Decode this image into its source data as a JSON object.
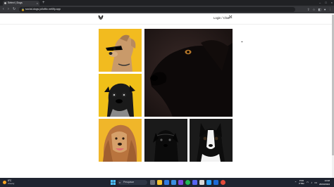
{
  "browser": {
    "tab_title": "Select | Dogs",
    "tab_close": "×",
    "new_tab": "+",
    "window_controls": [
      "–",
      "□",
      "×"
    ],
    "nav": {
      "back": "‹",
      "forward": "›",
      "reload": "↻"
    },
    "lock_icon": "🔒",
    "url": "social-dogs.jolloftic.netlify.app"
  },
  "page": {
    "header": {
      "login_label": "Login / Chat"
    },
    "photos": [
      {
        "id": "dog-sunglasses",
        "bg": "#f2bb1f"
      },
      {
        "id": "black-lab",
        "bg": "#231716"
      },
      {
        "id": "pug",
        "bg": "#f0c018"
      },
      {
        "id": "afghan",
        "bg": "#f0b62a"
      },
      {
        "id": "black-puppy",
        "bg": "#1a1a1a"
      },
      {
        "id": "boston-terrier",
        "bg": "#1a1a1a"
      }
    ]
  },
  "taskbar": {
    "weather": {
      "temp": "8°C",
      "desc": "Cloudy"
    },
    "search_placeholder": "Pesquisar",
    "tray": {
      "lang": "POR",
      "layout": "PTB2"
    },
    "clock": {
      "time": "13:08",
      "date": "26/03/2024"
    }
  }
}
